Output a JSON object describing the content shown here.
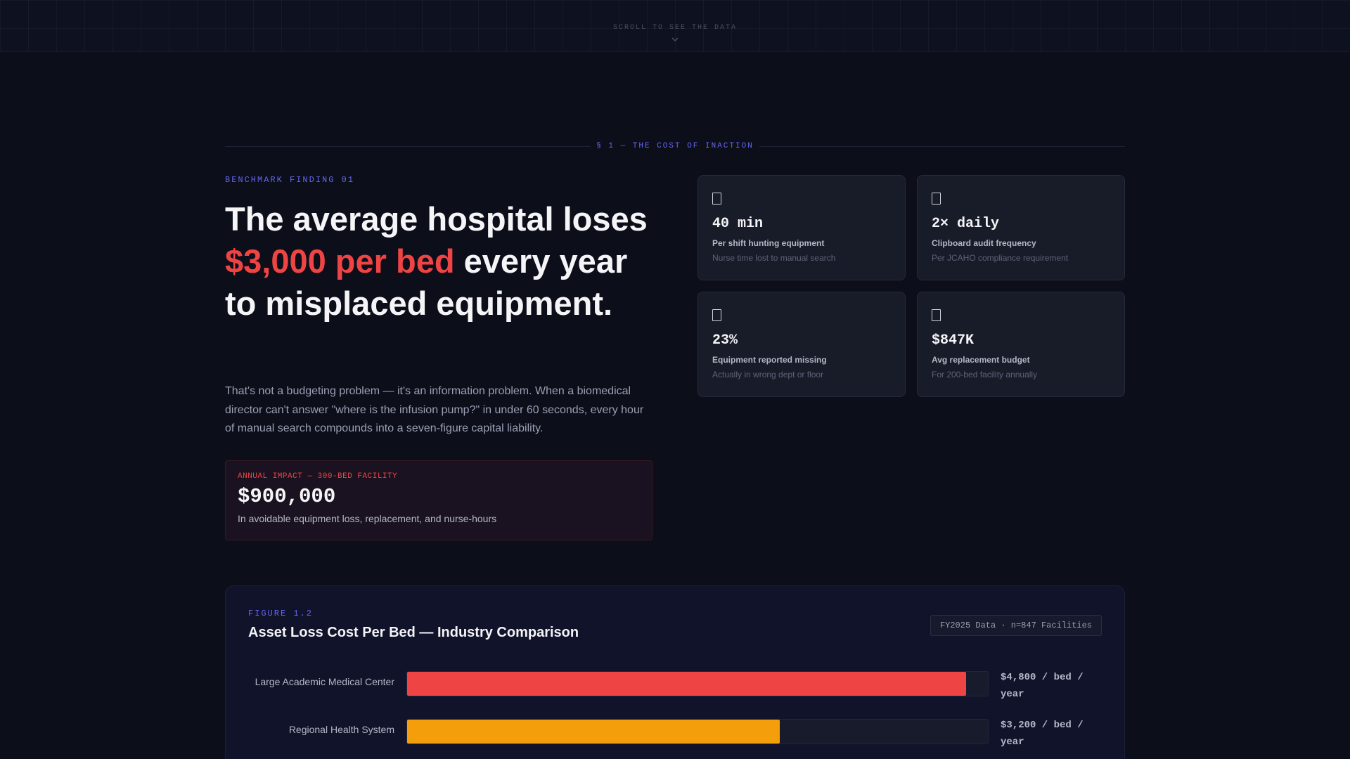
{
  "scroll_hint": "SCROLL TO SEE THE DATA",
  "section_label": "§ 1 — THE COST OF INACTION",
  "hero": {
    "eyebrow": "BENCHMARK FINDING 01",
    "headline_before": "The average hospital loses ",
    "headline_accent": "$3,000 per bed",
    "headline_after": " every year to misplaced equipment.",
    "accent_color": "#ef4444",
    "body": "That's not a budgeting problem — it's an information problem. When a biomedical director can't answer \"where is the infusion pump?\" in under 60 seconds, every hour of manual search compounds into a seven-figure capital liability."
  },
  "impact": {
    "label": "ANNUAL IMPACT — 300-BED FACILITY",
    "value": "$900,000",
    "description": "In avoidable equipment loss, replacement, and nurse-hours"
  },
  "stats": [
    {
      "icon": "clipboard-icon",
      "value": "40 min",
      "title": "Per shift hunting equipment",
      "subtitle": "Nurse time lost to manual search"
    },
    {
      "icon": "clipboard-icon",
      "value": "2× daily",
      "title": "Clipboard audit frequency",
      "subtitle": "Per JCAHO compliance requirement"
    },
    {
      "icon": "clipboard-icon",
      "value": "23%",
      "title": "Equipment reported missing",
      "subtitle": "Actually in wrong dept or floor"
    },
    {
      "icon": "clipboard-icon",
      "value": "$847K",
      "title": "Avg replacement budget",
      "subtitle": "For 200-bed facility annually"
    }
  ],
  "figure": {
    "eyebrow": "FIGURE 1.2",
    "title": "Asset Loss Cost Per Bed — Industry Comparison",
    "badge": "FY2025 Data · n=847 Facilities"
  },
  "chart_data": {
    "type": "bar",
    "orientation": "horizontal",
    "title": "Asset Loss Cost Per Bed — Industry Comparison",
    "categories": [
      "Large Academic Medical Center",
      "Regional Health System"
    ],
    "values": [
      4800,
      3200
    ],
    "value_labels": [
      "$4,800 / bed / year",
      "$3,200 / bed / year"
    ],
    "colors": [
      "#ef4444",
      "#f59e0b"
    ],
    "xlim": [
      0,
      5000
    ],
    "unit": "$ / bed / year"
  }
}
